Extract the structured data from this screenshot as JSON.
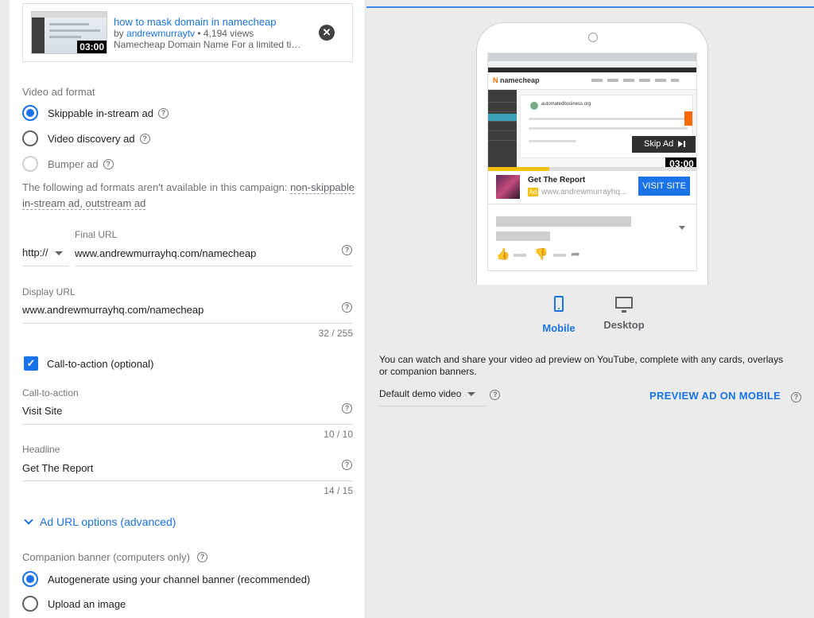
{
  "video": {
    "title": "how to mask domain in namecheap",
    "by_prefix": "by ",
    "channel": "andrewmurraytv",
    "views": " • 4,194 views",
    "description": "Namecheap Domain Name For a limited ti…",
    "duration": "03:00"
  },
  "ad_format": {
    "label": "Video ad format",
    "options": [
      {
        "label": "Skippable in-stream ad",
        "selected": true,
        "disabled": false
      },
      {
        "label": "Video discovery ad",
        "selected": false,
        "disabled": false
      },
      {
        "label": "Bumper ad",
        "selected": false,
        "disabled": true
      }
    ],
    "note_prefix": "The following ad formats aren't available in this campaign: ",
    "note_links": "non-skippable in-stream ad, outstream ad"
  },
  "final_url": {
    "label": "Final URL",
    "protocol": "http://",
    "value": "www.andrewmurrayhq.com/namecheap"
  },
  "display_url": {
    "label": "Display URL",
    "value": "www.andrewmurrayhq.com/namecheap",
    "counter": "32 / 255"
  },
  "cta_checkbox": {
    "label": "Call-to-action (optional)",
    "checked": true
  },
  "call_to_action": {
    "label": "Call-to-action",
    "value": "Visit Site",
    "counter": "10 / 10"
  },
  "headline": {
    "label": "Headline",
    "value": "Get The Report",
    "counter": "14 / 15"
  },
  "ad_url_options": "Ad URL options (advanced)",
  "companion": {
    "label": "Companion banner (computers only)",
    "options": [
      {
        "label": "Autogenerate using your channel banner (recommended)",
        "selected": true
      },
      {
        "label": "Upload an image",
        "selected": false
      }
    ]
  },
  "preview": {
    "site_logo": "namecheap",
    "site_domain": "automatedbusiness.org",
    "skip_label": "Skip Ad",
    "duration": "03:00",
    "progress": 0.29,
    "cta_headline": "Get The Report",
    "cta_badge": "Ad",
    "cta_url": "www.andrewmurrayhq...",
    "cta_button": "VISIT SITE"
  },
  "devices": {
    "mobile": "Mobile",
    "desktop": "Desktop",
    "active": "mobile"
  },
  "info_text": "You can watch and share your video ad preview on YouTube, complete with any cards, overlays or companion banners.",
  "demo_video": "Default demo video",
  "preview_button": "PREVIEW AD ON MOBILE",
  "colors": {
    "accent": "#1a73e8",
    "brand_orange": "#ff6a00",
    "ad_badge": "#f4c20d"
  }
}
